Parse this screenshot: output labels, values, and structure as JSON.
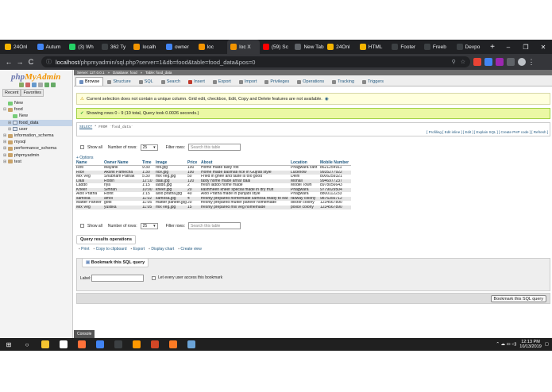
{
  "browser": {
    "tabs": [
      {
        "label": "24Onl",
        "color": "#f4b400"
      },
      {
        "label": "Autum",
        "color": "#4285f4"
      },
      {
        "label": "(3) Wh",
        "color": "#25d366"
      },
      {
        "label": "362 Ty",
        "color": "#3c4043"
      },
      {
        "label": "localh",
        "color": "#f29400"
      },
      {
        "label": "owner",
        "color": "#4285f4"
      },
      {
        "label": "loc",
        "color": "#f29400"
      },
      {
        "label": "loc X",
        "color": "#f29400"
      },
      {
        "label": "(59) Sc",
        "color": "#ff0000"
      },
      {
        "label": "New Tab",
        "color": "#5f6368"
      },
      {
        "label": "24Onl",
        "color": "#f4b400"
      },
      {
        "label": "HTML",
        "color": "#f4b400"
      },
      {
        "label": "Footer",
        "color": "#3c4043"
      },
      {
        "label": "Freeb",
        "color": "#3c4043"
      },
      {
        "label": "Devpo",
        "color": "#3c4043"
      }
    ],
    "active_tab_index": 7,
    "new_tab": "+",
    "window_controls": [
      "–",
      "❐",
      "✕"
    ],
    "url_host": "localhost",
    "url_path": "/phpmyadmin/sql.php?server=1&db=food&table=food_data&pos=0",
    "nav_back": "←",
    "nav_forward": "→",
    "nav_reload": "C",
    "lock_icon": "ⓘ"
  },
  "sidebar": {
    "logo_php": "php",
    "logo_my": "My",
    "logo_admin": "Admin",
    "tab_recent": "Recent",
    "tab_favorites": "Favorites",
    "tree": [
      {
        "label": "New",
        "indent": 4,
        "kind": "new",
        "expander": ""
      },
      {
        "label": "food",
        "indent": 4,
        "kind": "db",
        "expander": "⊟"
      },
      {
        "label": "New",
        "indent": 10,
        "kind": "new",
        "expander": ""
      },
      {
        "label": "food_data",
        "indent": 10,
        "kind": "table",
        "expander": "⊞",
        "selected": true
      },
      {
        "label": "user",
        "indent": 10,
        "kind": "table",
        "expander": "⊞"
      },
      {
        "label": "information_schema",
        "indent": 4,
        "kind": "db",
        "expander": "⊞"
      },
      {
        "label": "mysql",
        "indent": 4,
        "kind": "db",
        "expander": "⊞"
      },
      {
        "label": "performance_schema",
        "indent": 4,
        "kind": "db",
        "expander": "⊞"
      },
      {
        "label": "phpmyadmin",
        "indent": 4,
        "kind": "db",
        "expander": "⊞"
      },
      {
        "label": "test",
        "indent": 4,
        "kind": "db",
        "expander": "⊞"
      }
    ]
  },
  "main": {
    "breadcrumb": [
      "Server: 127.0.0.1",
      "Database: food",
      "Table: food_data"
    ],
    "menu": [
      {
        "label": "Browse",
        "color": "#6c8ebf"
      },
      {
        "label": "Structure",
        "color": "#888"
      },
      {
        "label": "SQL",
        "color": "#888"
      },
      {
        "label": "Search",
        "color": "#888"
      },
      {
        "label": "Insert",
        "color": "#c0392b"
      },
      {
        "label": "Export",
        "color": "#888"
      },
      {
        "label": "Import",
        "color": "#888"
      },
      {
        "label": "Privileges",
        "color": "#888"
      },
      {
        "label": "Operations",
        "color": "#888"
      },
      {
        "label": "Tracking",
        "color": "#888"
      },
      {
        "label": "Triggers",
        "color": "#888"
      }
    ],
    "notice": "Current selection does not contain a unique column. Grid edit, checkbox, Edit, Copy and Delete features are not available.",
    "success": "Showing rows 0 - 9 (10 total, Query took 0.0026 seconds.)",
    "sql_select": "SELECT",
    "sql_rest": " * FROM `food_data`",
    "sql_links": "[ Profiling [ Edit inline ] [ Edit ] [ Explain SQL ] [ Create PHP code ] [ Refresh ]",
    "show_all": "Show all",
    "num_rows_label": "Number of rows:",
    "num_rows_value": "25",
    "filter_label": "Filter rows:",
    "filter_placeholder": "Search this table",
    "options_link": "+ Options",
    "columns": [
      "Name",
      "Owner Name",
      "Time",
      "Image",
      "Price",
      "About",
      "Location",
      "Mobile Number"
    ],
    "rows": [
      [
        "Roti",
        "Mayank",
        "9:30",
        "roti.jpg",
        "100",
        "Home made tasty roti",
        "Phagwara cant",
        "8621254911"
      ],
      [
        "Rice",
        "Akshit Pamecha",
        "1:30",
        "rice.jpg",
        "100",
        "Home made basmati rice in Gujrati style",
        "Lucknow",
        "9935277922"
      ],
      [
        "Mix Veg",
        "Shubham Pathak",
        "5:30",
        "mix veg.jpg",
        "50",
        "Fried in ghee and taste is too good",
        "Delhi",
        "8006259321"
      ],
      [
        "Daal",
        "Robin",
        "12:10",
        "daal.jpg",
        "120",
        "tasty home made arhar daal",
        "Mohali",
        "9946977237"
      ],
      [
        "Laddo",
        "riya",
        "1:15",
        "laddo.jpg",
        "2",
        "fresh laddo home made",
        "Model Town",
        "8978056643"
      ],
      [
        "Kheer",
        "Simran",
        "10:00",
        "kheer.jpg",
        "20",
        "kashmeeri kheer special made in dry fruit",
        "Phagwara",
        "9779029504"
      ],
      [
        "Aloo Pratha",
        "Rohit",
        "1:15",
        "aloo pratha.jpg",
        "40",
        "Aloo Pratha made in punjabi style",
        "Phagwara",
        "8800112233"
      ],
      [
        "samosa",
        "amol",
        "11:02",
        "samosa.jpg",
        "4",
        "freshly prepared homemade samosa ready to eat",
        "railway colony",
        "9876356712"
      ],
      [
        "Matter Paneer",
        "gotti",
        "11:05",
        "matter paneer.jpg",
        "20",
        "freshly prepared mutter paneer homemade",
        "doctor colony",
        "1234567890"
      ],
      [
        "Mix Veg",
        "yustika",
        "11:05",
        "mix veg.jpg",
        "15",
        "freshly prepared mix veg homemade",
        "police colony",
        "1234567890"
      ]
    ],
    "qro_title": "Query results operations",
    "qro_links": [
      "Print",
      "Copy to clipboard",
      "Export",
      "Display chart",
      "Create view"
    ],
    "bookmark_title": "Bookmark this SQL query",
    "bookmark_label": "Label:",
    "bookmark_every": "Let every user access this bookmark",
    "bookmark_button": "Bookmark this SQL query",
    "console": "Console"
  },
  "taskbar": {
    "start_icon": "⊞",
    "search_icon": "○",
    "icons": [
      {
        "name": "file-explorer-icon",
        "color": "#f4c430"
      },
      {
        "name": "cortana-icon",
        "color": "#ffffff"
      },
      {
        "name": "firefox-icon",
        "color": "#ff7139"
      },
      {
        "name": "chrome-icon",
        "color": "#4285f4"
      },
      {
        "name": "terminal-icon",
        "color": "#3c4043"
      },
      {
        "name": "sublime-icon",
        "color": "#ff9800"
      },
      {
        "name": "powerpoint-icon",
        "color": "#d24726"
      },
      {
        "name": "xampp-icon",
        "color": "#fb7a24"
      },
      {
        "name": "notepad-icon",
        "color": "#6ba4d8"
      }
    ],
    "tray_icons": "⌃ ☁ ▭ ◁)",
    "time": "12:13 PM",
    "date": "10/13/2019"
  }
}
